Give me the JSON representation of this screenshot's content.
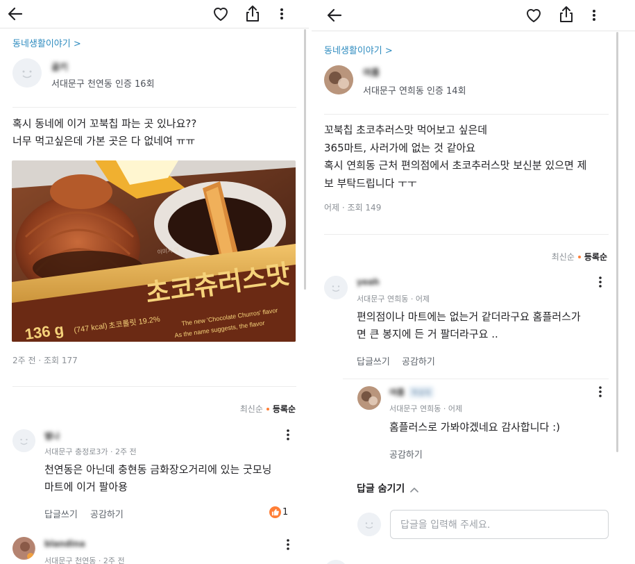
{
  "left": {
    "category": "동네생활이야기 >",
    "author": {
      "name": "골키",
      "meta": "서대문구 천연동 인증 16회"
    },
    "post": {
      "lines": [
        "혹시 동네에 이거 꼬북칩 파는 곳 있나요??",
        "너무 먹고싶은데 가본 곳은 다 없네여 ㅠㅠ"
      ],
      "meta": "2주 전 · 조회 177"
    },
    "product": {
      "big_text": "초코츄러스맛",
      "weight": "136 g",
      "kcal": "(747 kcal)",
      "choco": "초코롤릿 19.2%",
      "desc1": "The new 'Chocolate Churros' flavor",
      "desc2": "As the name suggests, the flavor",
      "watermark": "이미지 예"
    },
    "sort": {
      "latest": "최신순",
      "registered": "등록순"
    },
    "comments": [
      {
        "name": "별나",
        "meta": "서대문구 충정로3가 · 2주 전",
        "lines": [
          "천연동은 아닌데 충현동 금화장오거리에 있는 굿모닝",
          "마트에 이거 팔아용"
        ],
        "reply": "답글쓰기",
        "like": "공감하기",
        "like_count": "1"
      },
      {
        "name": "blandina",
        "meta": "서대문구 천연동 · 2주 전"
      }
    ]
  },
  "right": {
    "category": "동네생활이야기 >",
    "author": {
      "name": "여름",
      "meta": "서대문구 연희동 인증 14회"
    },
    "post": {
      "lines": [
        "꼬북칩 초코추러스맛 먹어보고 싶은데",
        "365마트, 사러가에 없는 것 같아요",
        "혹시 연희동 근처 편의점에서 초코추러스맛 보신분 있으면 제",
        "보 부탁드립니다 ㅜㅜ"
      ],
      "meta": "어제 · 조회 149"
    },
    "sort": {
      "latest": "최신순",
      "registered": "등록순"
    },
    "comment": {
      "name": "yeah",
      "meta": "서대문구 연희동 · 어제",
      "lines": [
        "편의점이나 마트에는 없는거 같더라구요 홈플러스가",
        "면 큰 봉지에 든 거 팔더라구요 .."
      ],
      "reply": "답글쓰기",
      "like": "공감하기"
    },
    "nested": {
      "name": "여름",
      "badge": "작성자",
      "meta": "서대문구 연희동 · 어제",
      "text": "홈플러스로 가봐야겠네요 감사합니다 :)",
      "like": "공감하기"
    },
    "hide_replies": "답글 숨기기",
    "reply_placeholder": "답글을 입력해 주세요."
  },
  "icons": {
    "back": "arrow-left-icon",
    "like": "heart-icon",
    "share": "share-icon",
    "more": "more-vertical-icon"
  },
  "colors": {
    "category": "#2d8bbf",
    "accent": "#ff7e36",
    "like_badge": "#ff7e36"
  }
}
